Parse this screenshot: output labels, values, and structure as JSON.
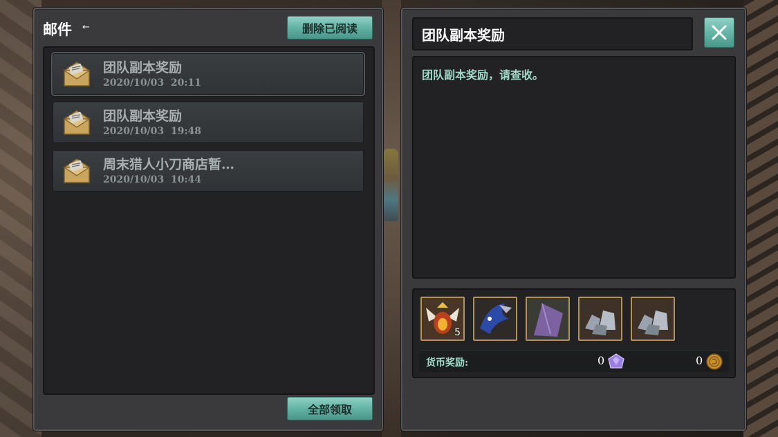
{
  "mail_panel": {
    "title": "邮件",
    "back_arrow": "←",
    "delete_read_label": "删除已阅读",
    "claim_all_label": "全部领取",
    "items": [
      {
        "subject": "团队副本奖励",
        "date": "2020/10/03  20:11",
        "selected": true,
        "icon": "envelope-icon"
      },
      {
        "subject": "团队副本奖励",
        "date": "2020/10/03  19:48",
        "selected": false,
        "icon": "envelope-icon"
      },
      {
        "subject": "周末猎人小刀商店暂…",
        "date": "2020/10/03  10:44",
        "selected": false,
        "icon": "envelope-icon"
      }
    ]
  },
  "detail_panel": {
    "title": "团队副本奖励",
    "close_icon": "close-icon",
    "body": "团队副本奖励，请查收。",
    "rewards": [
      {
        "name": "winged-egg-icon",
        "count": "5"
      },
      {
        "name": "blue-creature-icon",
        "count": ""
      },
      {
        "name": "purple-feather-icon",
        "count": ""
      },
      {
        "name": "ore-pile-icon",
        "count": ""
      },
      {
        "name": "ore-pile-icon",
        "count": ""
      }
    ],
    "currency_label": "货币奖励:",
    "currency": [
      {
        "value": "0",
        "icon": "purple-gem-icon"
      },
      {
        "value": "0",
        "icon": "gold-coin-icon"
      }
    ]
  },
  "colors": {
    "button_teal": "#5fb0a2",
    "body_text": "#9fd9c8",
    "slot_border": "#b4935a"
  }
}
